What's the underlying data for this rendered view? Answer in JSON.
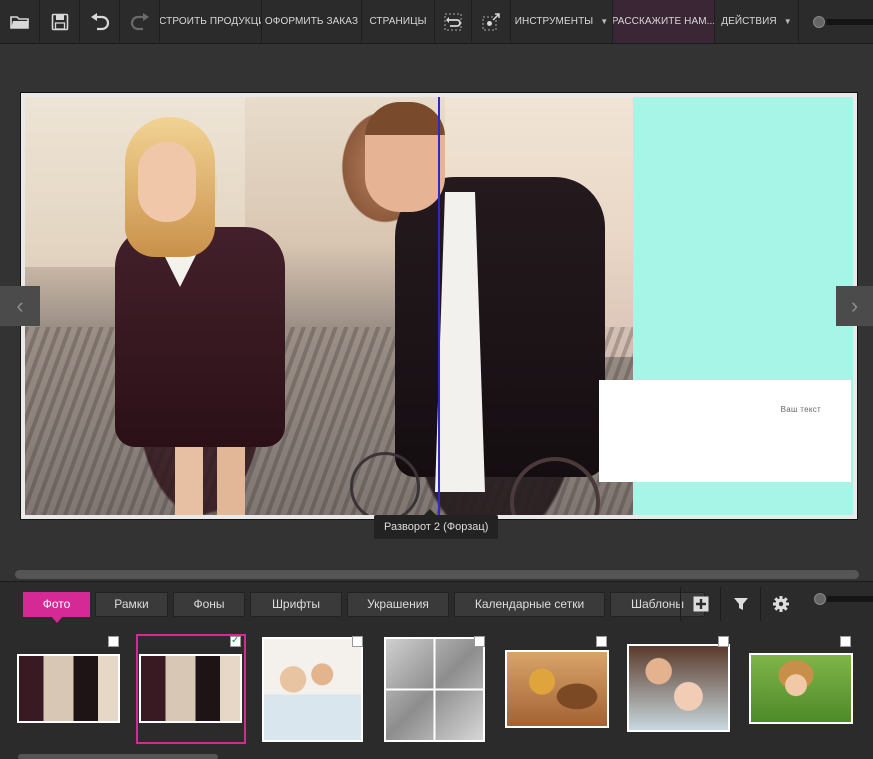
{
  "toolbar": {
    "icons": [
      "open-folder-icon",
      "save-icon",
      "undo-icon",
      "redo-icon"
    ],
    "items": [
      {
        "label": "НАСТРОИТЬ ПРОДУКЦИЮ"
      },
      {
        "label": "ОФОРМИТЬ ЗАКАЗ"
      },
      {
        "label": "СТРАНИЦЫ"
      },
      {
        "label": "ИНСТРУМЕНТЫ"
      },
      {
        "label": "РАССКАЖИТЕ НАМ..."
      },
      {
        "label": "ДЕЙСТВИЯ"
      }
    ]
  },
  "canvas": {
    "text_placeholder": "Ваш текст",
    "spread_label": "Разворот 2 (Форзац)",
    "right_page_color": "#a6f5e6",
    "fold_line_color": "#2a2acc"
  },
  "panel": {
    "tabs": [
      "Фото",
      "Рамки",
      "Фоны",
      "Шрифты",
      "Украшения",
      "Календарные сетки",
      "Шаблоны"
    ],
    "active_tab": "Фото",
    "accent_color": "#d52a95",
    "tool_icons": [
      "add-icon",
      "filter-icon",
      "settings-gear-icon"
    ]
  }
}
